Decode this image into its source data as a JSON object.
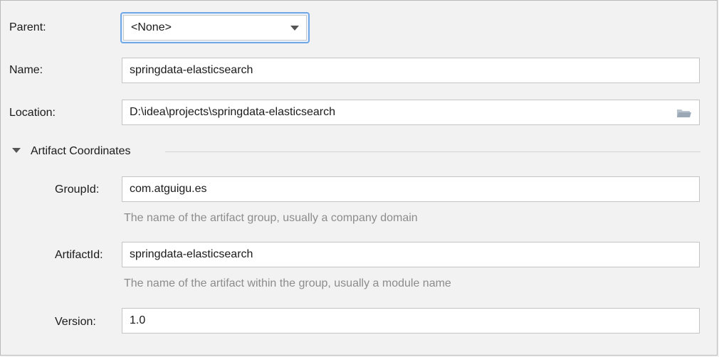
{
  "parent": {
    "label": "Parent:",
    "value": "<None>"
  },
  "name": {
    "label": "Name:",
    "value": "springdata-elasticsearch"
  },
  "location": {
    "label": "Location:",
    "value": "D:\\idea\\projects\\springdata-elasticsearch",
    "icon": "folder-icon"
  },
  "artifact": {
    "title": "Artifact Coordinates",
    "toggle_icon": "chevron-down-icon",
    "group_id": {
      "label": "GroupId:",
      "value": "com.atguigu.es",
      "hint": "The name of the artifact group, usually a company domain"
    },
    "artifact_id": {
      "label": "ArtifactId:",
      "value": "springdata-elasticsearch",
      "hint": "The name of the artifact within the group, usually a module name"
    },
    "version": {
      "label": "Version:",
      "value": "1.0"
    }
  },
  "colors": {
    "focus_border": "#6fa7e6",
    "hint_text": "#8c8c8c",
    "background": "#f2f2f2"
  }
}
